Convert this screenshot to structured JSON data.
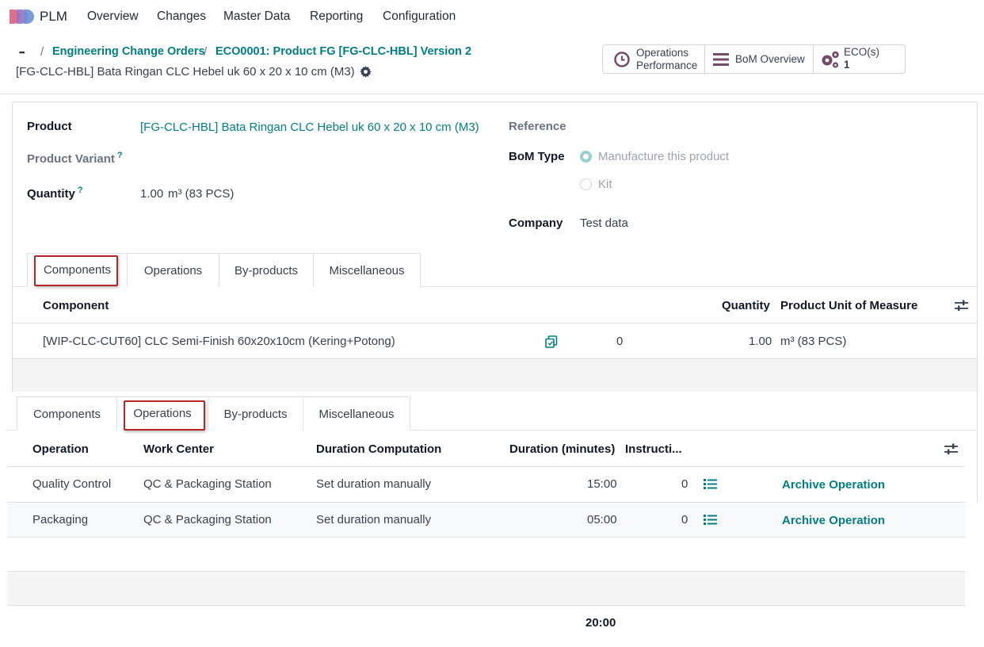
{
  "app": {
    "name": "PLM"
  },
  "nav": [
    "Overview",
    "Changes",
    "Master Data",
    "Reporting",
    "Configuration"
  ],
  "breadcrumb": {
    "dots": "•••",
    "items": [
      "Engineering Change Orders",
      "ECO0001: Product FG [FG-CLC-HBL] Version 2"
    ],
    "separator": "/"
  },
  "record_title": "[FG-CLC-HBL] Bata Ringan CLC Hebel uk 60 x 20 x 10 cm (M3)",
  "smart_buttons": {
    "operations_performance": [
      "Operations",
      "Performance"
    ],
    "bom_overview": "BoM Overview",
    "ecos": {
      "label": "ECO(s)",
      "count": "1"
    }
  },
  "form": {
    "product_label": "Product",
    "product_value": "[FG-CLC-HBL] Bata Ringan CLC Hebel uk 60 x 20 x 10 cm (M3)",
    "variant_label": "Product Variant",
    "quantity_label": "Quantity",
    "quantity_value": "1.00",
    "quantity_uom": "m³ (83 PCS)",
    "help_mark": "?",
    "reference_label": "Reference",
    "bom_type_label": "BoM Type",
    "bom_type_options": [
      "Manufacture this product",
      "Kit"
    ],
    "company_label": "Company",
    "company_value": "Test data"
  },
  "tabs": [
    "Components",
    "Operations",
    "By-products",
    "Miscellaneous"
  ],
  "components": {
    "headers": {
      "component": "Component",
      "quantity": "Quantity",
      "uom": "Product Unit of Measure"
    },
    "rows": [
      {
        "component": "[WIP-CLC-CUT60] CLC Semi-Finish 60x20x10cm (Kering+Potong)",
        "count": "0",
        "quantity": "1.00",
        "uom": "m³ (83 PCS)"
      }
    ]
  },
  "operations": {
    "headers": {
      "operation": "Operation",
      "work_center": "Work Center",
      "duration_computation": "Duration Computation",
      "duration": "Duration (minutes)",
      "instructions": "Instructi..."
    },
    "rows": [
      {
        "operation": "Quality Control",
        "work_center": "QC & Packaging Station",
        "computation": "Set duration manually",
        "duration": "15:00",
        "instructions": "0",
        "action": "Archive Operation"
      },
      {
        "operation": "Packaging",
        "work_center": "QC & Packaging Station",
        "computation": "Set duration manually",
        "duration": "05:00",
        "instructions": "0",
        "action": "Archive Operation"
      }
    ],
    "total_duration": "20:00"
  },
  "colors": {
    "accent": "#017e84",
    "highlight_box": "#b42727",
    "logo": [
      "#e16e8c",
      "#9473c4",
      "#f0b657"
    ]
  }
}
